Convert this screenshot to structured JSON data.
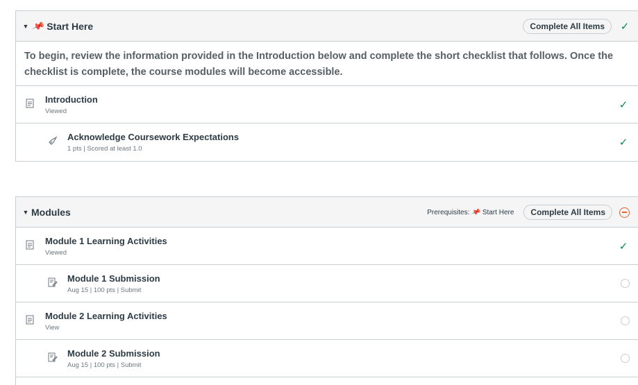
{
  "start_module": {
    "title": "Start Here",
    "complete_label": "Complete All Items",
    "overview": "To begin, review the information provided in the Introduction below and complete the short checklist that follows. Once the checklist is complete, the course modules will become accessible.",
    "items": [
      {
        "name": "Introduction",
        "meta": "Viewed",
        "icon": "page-icon",
        "status": "complete"
      },
      {
        "name": "Acknowledge Coursework Expectations",
        "meta": "1 pts  |  Scored at least 1.0",
        "icon": "quiz-rocket-icon",
        "status": "complete"
      }
    ]
  },
  "modules_module": {
    "title": "Modules",
    "prereq_label": "Prerequisites:",
    "prereq_value": "Start Here",
    "complete_label": "Complete All Items",
    "status": "locked",
    "items": [
      {
        "name": "Module 1 Learning Activities",
        "meta": "Viewed",
        "icon": "page-icon",
        "status": "complete"
      },
      {
        "name": "Module 1 Submission",
        "meta": "Aug 15  |  100 pts  |  Submit",
        "icon": "assignment-icon",
        "status": "incomplete"
      },
      {
        "name": "Module 2 Learning Activities",
        "meta": "View",
        "icon": "page-icon",
        "status": "incomplete"
      },
      {
        "name": "Module 2 Submission",
        "meta": "Aug 15  |  100 pts  |  Submit",
        "icon": "assignment-icon",
        "status": "incomplete"
      }
    ]
  },
  "colors": {
    "complete": "#0b874b",
    "locked": "#e66135",
    "pin": "#e0061f",
    "border": "#c7cdd1",
    "header_bg": "#f5f5f5"
  }
}
